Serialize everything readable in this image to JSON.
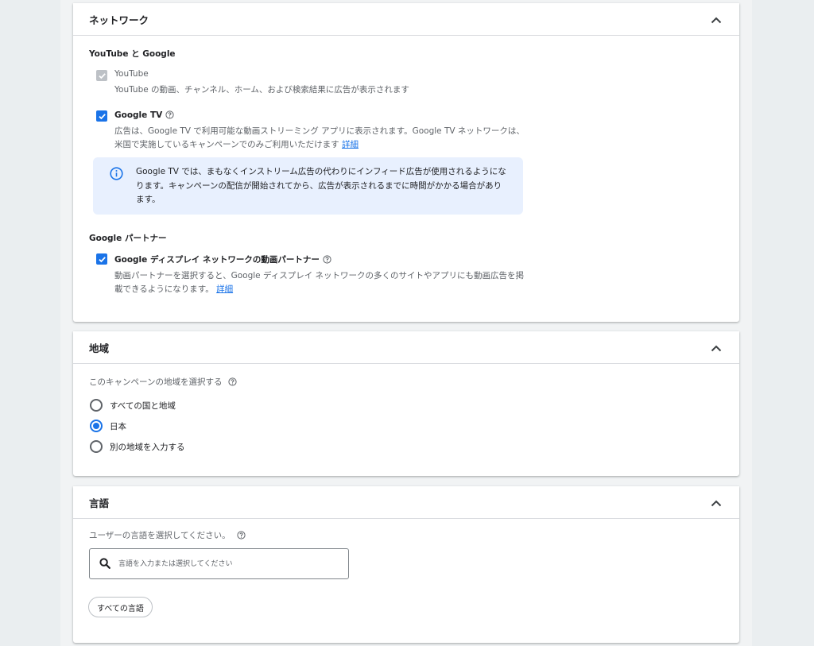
{
  "network": {
    "title": "ネットワーク",
    "youtube_section": {
      "heading": "YouTube と Google",
      "youtube": {
        "label": "YouTube",
        "description": "YouTube の動画、チャンネル、ホーム、および検索結果に広告が表示されます",
        "checked": true,
        "disabled": true
      },
      "google_tv": {
        "label": "Google TV",
        "description": "広告は、Google TV で利用可能な動画ストリーミング アプリに表示されます。Google TV ネットワークは、米国で実施しているキャンペーンでのみご利用いただけます",
        "link": "詳細",
        "checked": true
      },
      "info": "Google TV では、まもなくインストリーム広告の代わりにインフィード広告が使用されるようになります。キャンペーンの配信が開始されてから、広告が表示されるまでに時間がかかる場合があります。"
    },
    "partners_section": {
      "heading": "Google パートナー",
      "display_partners": {
        "label": "Google ディスプレイ ネットワークの動画パートナー",
        "description": "動画パートナーを選択すると、Google ディスプレイ ネットワークの多くのサイトやアプリにも動画広告を掲載できるようになります。",
        "link": "詳細",
        "checked": true
      }
    }
  },
  "region": {
    "title": "地域",
    "question": "このキャンペーンの地域を選択する",
    "options": [
      "すべての国と地域",
      "日本",
      "別の地域を入力する"
    ],
    "selected_index": 1
  },
  "language": {
    "title": "言語",
    "question": "ユーザーの言語を選択してください。",
    "search_placeholder": "言語を入力または選択してください",
    "chip": "すべての言語"
  },
  "colors": {
    "accent": "#1a73e8",
    "info_bg": "#e8f0fe",
    "page_bg": "#eaeef0"
  },
  "icons": {
    "collapse": "chevron-up-icon",
    "help": "help-circle-icon",
    "info": "info-icon",
    "search": "search-icon",
    "check": "check-icon"
  }
}
